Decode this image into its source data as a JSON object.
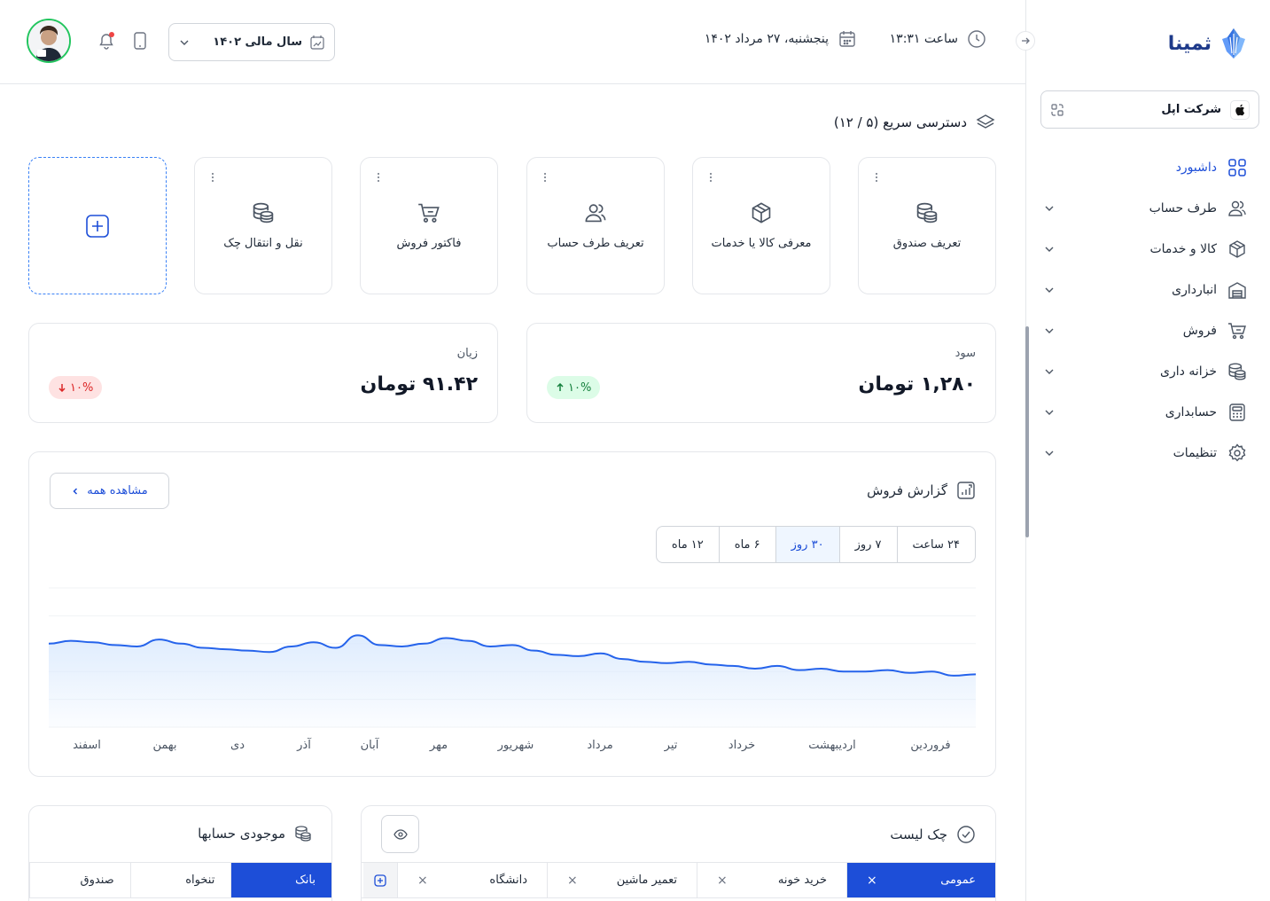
{
  "brand": {
    "name": "ثمینا"
  },
  "company": {
    "name": "شرکت اپل"
  },
  "nav": [
    {
      "label": "داشبورد",
      "icon": "grid-icon",
      "active": true
    },
    {
      "label": "طرف حساب",
      "icon": "users-icon"
    },
    {
      "label": "کالا و خدمات",
      "icon": "box-icon"
    },
    {
      "label": "انبارداری",
      "icon": "warehouse-icon"
    },
    {
      "label": "فروش",
      "icon": "cart-icon"
    },
    {
      "label": "خزانه داری",
      "icon": "coins-icon"
    },
    {
      "label": "حسابداری",
      "icon": "calculator-icon"
    },
    {
      "label": "تنظیمات",
      "icon": "gear-icon"
    }
  ],
  "header": {
    "time": "ساعت ۱۳:۳۱",
    "date": "پنجشنبه، ۲۷ مرداد ۱۴۰۲",
    "fiscal_year": "سال مالی ۱۴۰۲"
  },
  "quick_access": {
    "title": "دسترسی سریع (۵ / ۱۲)",
    "items": [
      {
        "label": "تعریف صندوق",
        "icon": "coins-icon"
      },
      {
        "label": "معرفی کالا یا خدمات",
        "icon": "box-icon"
      },
      {
        "label": "تعریف طرف حساب",
        "icon": "users-icon"
      },
      {
        "label": "فاکتور فروش",
        "icon": "cart-icon"
      },
      {
        "label": "نقل و انتقال چک",
        "icon": "coins-icon"
      }
    ]
  },
  "stats": {
    "profit": {
      "label": "سود",
      "value": "۱,۲۸۰ تومان",
      "change": "۱۰%",
      "direction": "up"
    },
    "loss": {
      "label": "زیان",
      "value": "۹۱.۴۲ تومان",
      "change": "۱۰%",
      "direction": "down"
    }
  },
  "sales_report": {
    "title": "گزارش فروش",
    "view_all": "مشاهده همه",
    "tabs": [
      "۲۴ ساعت",
      "۷ روز",
      "۳۰ روز",
      "۶ ماه",
      "۱۲ ماه"
    ],
    "active_tab": 2
  },
  "chart_data": {
    "type": "area",
    "x": [
      "فروردین",
      "اردیبهشت",
      "خرداد",
      "تیر",
      "مرداد",
      "شهریور",
      "مهر",
      "آبان",
      "آذر",
      "دی",
      "بهمن",
      "اسفند"
    ],
    "series": [
      {
        "values": [
          60,
          62,
          61,
          59,
          58,
          63,
          60,
          57,
          56,
          55,
          54,
          58,
          61,
          57,
          66,
          59,
          58,
          60,
          64,
          62,
          58,
          59,
          55,
          52,
          51,
          53,
          49,
          47,
          46,
          47,
          45,
          44,
          42,
          44,
          41,
          42,
          40,
          40,
          41,
          39,
          40,
          37,
          38
        ]
      }
    ],
    "direction": "rtl",
    "grid": true,
    "color": "#2563eb",
    "fill": "#dbeafe",
    "ylim": [
      0,
      100
    ]
  },
  "checklist": {
    "title": "چک لیست",
    "tabs": [
      {
        "label": "عمومی",
        "active": true
      },
      {
        "label": "خرید خونه"
      },
      {
        "label": "تعمیر ماشین"
      },
      {
        "label": "دانشگاه"
      }
    ]
  },
  "balances": {
    "title": "موجودی حسابها",
    "tabs": [
      {
        "label": "بانک",
        "active": true
      },
      {
        "label": "تنخواه"
      },
      {
        "label": "صندوق"
      }
    ]
  }
}
